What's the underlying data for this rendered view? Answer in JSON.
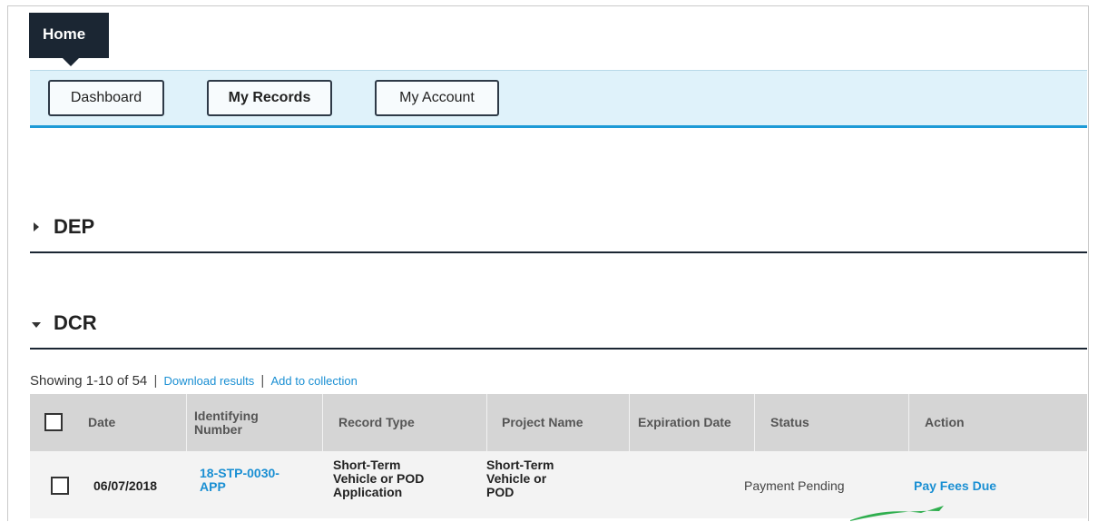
{
  "nav": {
    "home_tab": "Home",
    "buttons": [
      "Dashboard",
      "My Records",
      "My Account"
    ]
  },
  "sections": {
    "dep": {
      "label": "DEP",
      "state": "collapsed"
    },
    "dcr": {
      "label": "DCR",
      "state": "expanded"
    }
  },
  "results": {
    "showing": "Showing 1-10 of 54",
    "separator": "|",
    "download": "Download results",
    "add_collection": "Add to collection"
  },
  "table": {
    "headers": {
      "date": "Date",
      "id_line1": "Identifying",
      "id_line2": "Number",
      "record_type": "Record Type",
      "project_name": "Project Name",
      "expiration": "Expiration Date",
      "status": "Status",
      "action": "Action"
    },
    "rows": [
      {
        "date": "06/07/2018",
        "id_line1": "18-STP-0030-",
        "id_line2": "APP",
        "type_line1": "Short-Term",
        "type_line2": "Vehicle or POD",
        "type_line3": "Application",
        "name_line1": "Short-Term",
        "name_line2": "Vehicle or",
        "name_line3": "POD",
        "expiration": "",
        "status": "Payment Pending",
        "action": "Pay Fees Due"
      }
    ]
  },
  "colors": {
    "nav_bg": "#dff2fa",
    "accent_blue": "#1d9ad6",
    "link": "#1a8fd3",
    "dark": "#1b2633",
    "header_bg": "#d5d5d5",
    "row_bg": "#f3f3f3"
  }
}
